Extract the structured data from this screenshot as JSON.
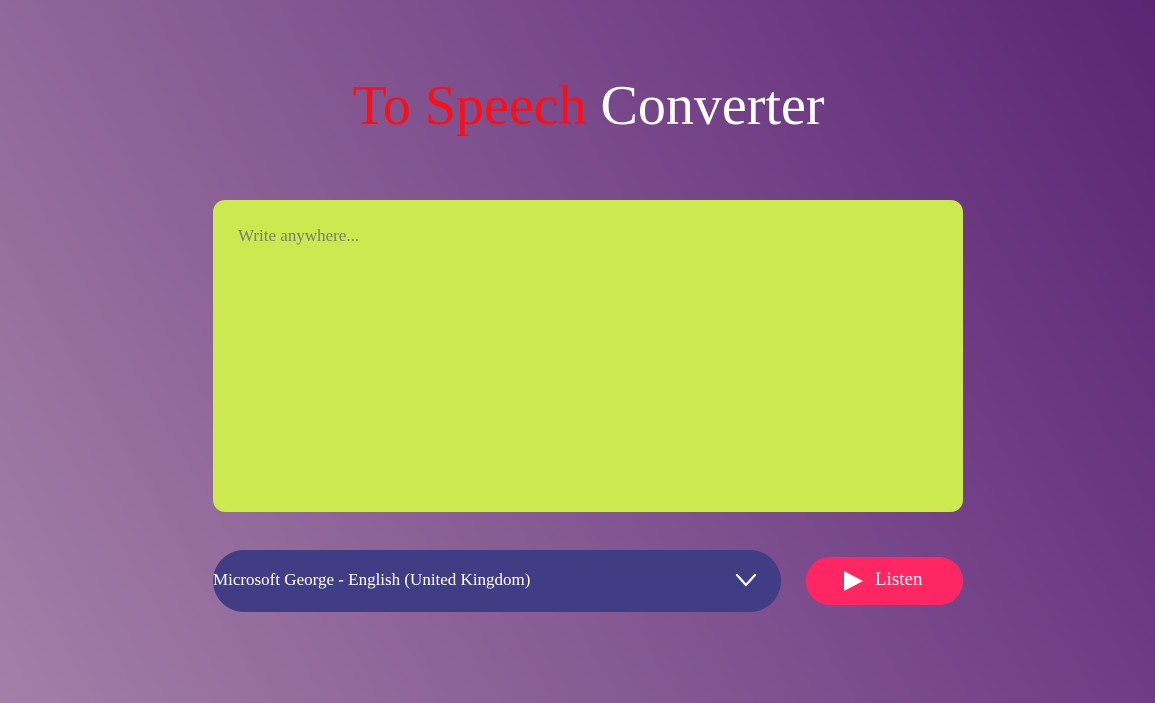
{
  "header": {
    "title_accent": "To Speech",
    "title_rest": "Converter"
  },
  "editor": {
    "placeholder": "Write anywhere...",
    "value": ""
  },
  "voice_select": {
    "selected": "Microsoft George - English (United Kingdom)",
    "icon": "chevron-down-icon"
  },
  "listen_button": {
    "label": "Listen",
    "icon": "play-icon"
  },
  "colors": {
    "accent_red": "#ff0d14",
    "editor_bg": "#cce950",
    "select_bg": "#413d85",
    "button_bg": "#ff2763"
  }
}
